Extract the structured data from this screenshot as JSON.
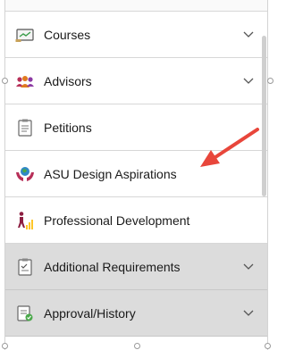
{
  "menu": {
    "items": [
      {
        "label": "Courses",
        "icon": "courses-icon",
        "expandable": true,
        "shaded": false
      },
      {
        "label": "Advisors",
        "icon": "advisors-icon",
        "expandable": true,
        "shaded": false
      },
      {
        "label": "Petitions",
        "icon": "petitions-icon",
        "expandable": false,
        "shaded": false
      },
      {
        "label": "ASU Design Aspirations",
        "icon": "design-aspirations-icon",
        "expandable": false,
        "shaded": false
      },
      {
        "label": "Professional Development",
        "icon": "professional-development-icon",
        "expandable": false,
        "shaded": false
      },
      {
        "label": "Additional Requirements",
        "icon": "additional-requirements-icon",
        "expandable": true,
        "shaded": true
      },
      {
        "label": "Approval/History",
        "icon": "approval-history-icon",
        "expandable": true,
        "shaded": true
      }
    ]
  },
  "colors": {
    "annotation_arrow": "#e8463b",
    "shaded_row": "#dcdcdc",
    "divider": "#d7d7d7"
  }
}
